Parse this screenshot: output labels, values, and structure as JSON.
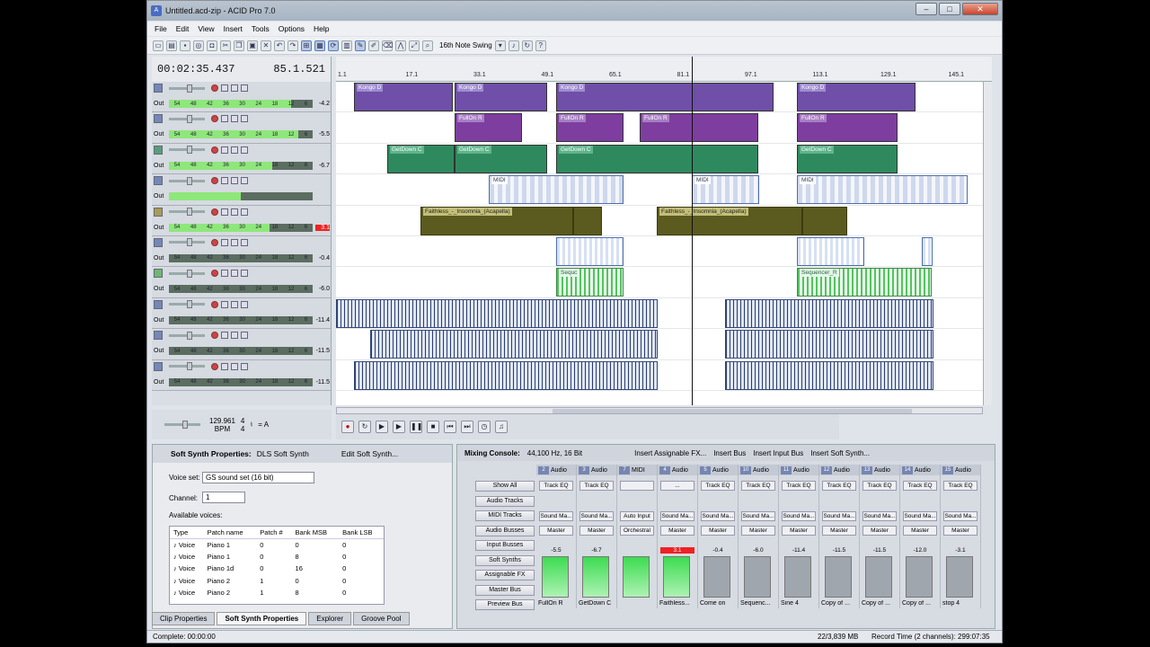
{
  "window": {
    "title": "Untitled.acd-zip - ACID Pro 7.0"
  },
  "menu": [
    "File",
    "Edit",
    "View",
    "Insert",
    "Tools",
    "Options",
    "Help"
  ],
  "toolbar": {
    "swing": "16th Note Swing"
  },
  "time": {
    "position": "00:02:35.437",
    "measure": "85.1.521"
  },
  "ruler": [
    "1.1",
    "17.1",
    "33.1",
    "49.1",
    "65.1",
    "81.1",
    "97.1",
    "113.1",
    "129.1",
    "145.1"
  ],
  "tracks": [
    {
      "color": "#7388b8",
      "meter_fill": 0.85,
      "value": "-4.2",
      "red": false
    },
    {
      "color": "#7388b8",
      "meter_fill": 0.9,
      "value": "-5.5",
      "red": false
    },
    {
      "color": "#54a07a",
      "meter_fill": 0.72,
      "value": "-6.7",
      "red": false
    },
    {
      "color": "#7388b8",
      "meter_fill": 0.5,
      "value": "",
      "red": false
    },
    {
      "color": "#a89c52",
      "meter_fill": 0.7,
      "value": "3.1",
      "red": true
    },
    {
      "color": "#7388b8",
      "meter_fill": 0.0,
      "value": "-0.4",
      "red": false
    },
    {
      "color": "#6fb870",
      "meter_fill": 0.0,
      "value": "-6.0",
      "red": false
    },
    {
      "color": "#7388b8",
      "meter_fill": 0.0,
      "value": "-11.4",
      "red": false
    },
    {
      "color": "#7388b8",
      "meter_fill": 0.0,
      "value": "-11.5",
      "red": false
    },
    {
      "color": "#7388b8",
      "meter_fill": 0.0,
      "value": "-11.5",
      "red": false
    }
  ],
  "meter_scale": [
    "54",
    "48",
    "42",
    "36",
    "30",
    "24",
    "18",
    "12",
    "6"
  ],
  "tempo": {
    "bpm": "129.961",
    "bpm_label": "BPM",
    "sig_top": "4",
    "sig_bottom": "4",
    "key": "= A"
  },
  "clip_labels": {
    "kongo": "Kongo D",
    "fullon": "FullOn R",
    "getdown": "GetDown C",
    "midi": "MIDI",
    "faithless": "Faithless_-_Insomnia_(Acapella)",
    "sequ": "Sequc",
    "sequencer": "Sequencer_R"
  },
  "softsynth": {
    "title": "Soft Synth Properties:",
    "device": "DLS Soft Synth",
    "edit": "Edit Soft Synth...",
    "voiceset_label": "Voice set:",
    "voiceset": "GS sound set (16 bit)",
    "channel_label": "Channel:",
    "channel": "1",
    "available": "Available voices:",
    "columns": [
      "Type",
      "Patch name",
      "Patch #",
      "Bank MSB",
      "Bank LSB"
    ],
    "rows": [
      [
        "Voice",
        "Piano 1",
        "0",
        "0",
        "0"
      ],
      [
        "Voice",
        "Piano 1",
        "0",
        "8",
        "0"
      ],
      [
        "Voice",
        "Piano 1d",
        "0",
        "16",
        "0"
      ],
      [
        "Voice",
        "Piano 2",
        "1",
        "0",
        "0"
      ],
      [
        "Voice",
        "Piano 2",
        "1",
        "8",
        "0"
      ]
    ],
    "tabs": [
      "Clip Properties",
      "Soft Synth Properties",
      "Explorer",
      "Groove Pool"
    ]
  },
  "mixer": {
    "title": "Mixing Console:",
    "format": "44,100 Hz, 16 Bit",
    "actions": [
      "Insert Assignable FX...",
      "Insert Bus",
      "Insert Input Bus",
      "Insert Soft Synth..."
    ],
    "side": [
      "Show All",
      "Audio Tracks",
      "MIDI Tracks",
      "Audio Busses",
      "Input Busses",
      "Soft Synths",
      "Assignable FX",
      "Master Bus",
      "Preview Bus"
    ],
    "strips": [
      {
        "num": "2",
        "type": "Audio",
        "fx": "Track EQ",
        "src": "Sound Ma...",
        "out": "Master",
        "level": "-5.5",
        "red": false,
        "on": true,
        "name": "FullOn R"
      },
      {
        "num": "3",
        "type": "Audio",
        "fx": "Track EQ",
        "src": "Sound Ma...",
        "out": "Master",
        "level": "-6.7",
        "red": false,
        "on": true,
        "name": "GetDown C"
      },
      {
        "num": "7",
        "type": "MIDI",
        "fx": "",
        "src": "Auto Input",
        "out": "Orchestral",
        "level": "",
        "red": false,
        "on": true,
        "name": ""
      },
      {
        "num": "4",
        "type": "Audio",
        "fx": "...",
        "src": "Sound Ma...",
        "out": "Master",
        "level": "3.1",
        "red": true,
        "on": true,
        "name": "Faithless..."
      },
      {
        "num": "5",
        "type": "Audio",
        "fx": "Track EQ",
        "src": "Sound Ma...",
        "out": "Master",
        "level": "-0.4",
        "red": false,
        "on": false,
        "name": "Come on"
      },
      {
        "num": "10",
        "type": "Audio",
        "fx": "Track EQ",
        "src": "Sound Ma...",
        "out": "Master",
        "level": "-6.0",
        "red": false,
        "on": false,
        "name": "Sequenc..."
      },
      {
        "num": "11",
        "type": "Audio",
        "fx": "Track EQ",
        "src": "Sound Ma...",
        "out": "Master",
        "level": "-11.4",
        "red": false,
        "on": false,
        "name": "Sine 4"
      },
      {
        "num": "12",
        "type": "Audio",
        "fx": "Track EQ",
        "src": "Sound Ma...",
        "out": "Master",
        "level": "-11.5",
        "red": false,
        "on": false,
        "name": "Copy of ..."
      },
      {
        "num": "13",
        "type": "Audio",
        "fx": "Track EQ",
        "src": "Sound Ma...",
        "out": "Master",
        "level": "-11.5",
        "red": false,
        "on": false,
        "name": "Copy of ..."
      },
      {
        "num": "14",
        "type": "Audio",
        "fx": "Track EQ",
        "src": "Sound Ma...",
        "out": "Master",
        "level": "-12.0",
        "red": false,
        "on": false,
        "name": "Copy of ..."
      },
      {
        "num": "15",
        "type": "Audio",
        "fx": "Track EQ",
        "src": "Sound Ma...",
        "out": "Master",
        "level": "-3.1",
        "red": false,
        "on": false,
        "name": "stop 4"
      }
    ]
  },
  "status": {
    "left": "Complete: 00:00:00",
    "mem": "22/3,839 MB",
    "record": "Record Time (2 channels): 299:07:35"
  }
}
